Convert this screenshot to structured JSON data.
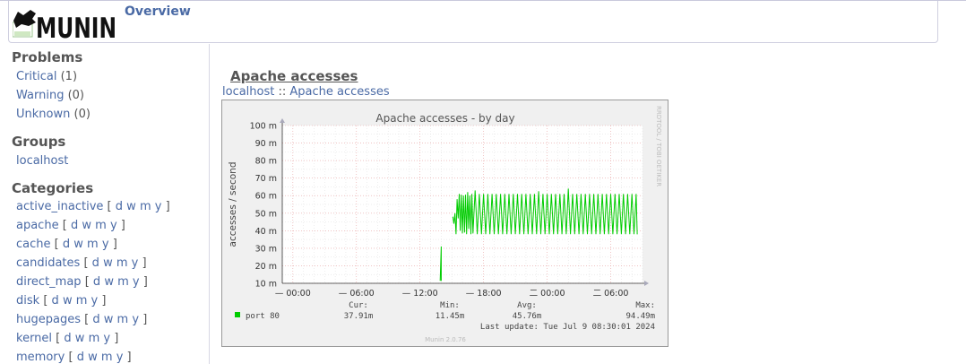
{
  "header": {
    "logo_text": "MUNIN",
    "overview_label": "Overview"
  },
  "sidebar": {
    "problems": {
      "title": "Problems",
      "items": [
        {
          "label": "Critical",
          "count": "(1)"
        },
        {
          "label": "Warning",
          "count": "(0)"
        },
        {
          "label": "Unknown",
          "count": "(0)"
        }
      ]
    },
    "groups": {
      "title": "Groups",
      "items": [
        {
          "label": "localhost"
        }
      ]
    },
    "categories": {
      "title": "Categories",
      "period_labels": [
        "d",
        "w",
        "m",
        "y"
      ],
      "items": [
        {
          "label": "active_inactive"
        },
        {
          "label": "apache"
        },
        {
          "label": "cache"
        },
        {
          "label": "candidates"
        },
        {
          "label": "direct_map"
        },
        {
          "label": "disk"
        },
        {
          "label": "hugepages"
        },
        {
          "label": "kernel"
        },
        {
          "label": "memory"
        }
      ]
    }
  },
  "main": {
    "title": "Apache accesses",
    "breadcrumb": {
      "host": "localhost",
      "separator": "::",
      "page": "Apache accesses"
    }
  },
  "graph": {
    "side_text": "RRDTOOL / TOBI OETIKER",
    "footer_text": "Munin 2.0.76",
    "last_update_label": "Last update:",
    "last_update_value": "Tue Jul  9 08:30:01 2024",
    "legend": {
      "headers": [
        "Cur:",
        "Min:",
        "Avg:",
        "Max:"
      ],
      "rows": [
        {
          "name": "port 80",
          "color": "#00cc00",
          "values": [
            "37.91m",
            "11.45m",
            "45.76m",
            "94.49m"
          ]
        }
      ]
    }
  },
  "colors": {
    "link": "#4a6aa5",
    "series": "#00cc00",
    "grid_major": "#e6a0a0",
    "grid_minor": "#dcdcdc",
    "plot_bg": "#ffffff",
    "graph_bg": "#f0f0f0"
  },
  "chart_data": {
    "type": "line",
    "title": "Apache accesses - by day",
    "xlabel": "",
    "ylabel": "accesses / second",
    "x_unit": "hours",
    "x_tick_labels": [
      "00:00",
      "06:00",
      "12:00",
      "18:00",
      "00:00",
      "06:00"
    ],
    "x_tick_label_markers": [
      "—",
      "—",
      "—",
      "—",
      "二",
      "二"
    ],
    "x_tick_hours": [
      0,
      6,
      12,
      18,
      24,
      30
    ],
    "xlim": [
      -1,
      33
    ],
    "y_tick_labels": [
      "10 m",
      "20 m",
      "30 m",
      "40 m",
      "50 m",
      "60 m",
      "70 m",
      "80 m",
      "90 m",
      "100 m"
    ],
    "y_tick_values": [
      10,
      20,
      30,
      40,
      50,
      60,
      70,
      80,
      90,
      100
    ],
    "ylim": [
      10,
      100
    ],
    "y_unit": "m",
    "grid": true,
    "series": [
      {
        "name": "port 80",
        "color": "#00cc00",
        "x": [
          13.9,
          14.0,
          14.0,
          15.1,
          15.2,
          15.3,
          15.4,
          15.5,
          15.6,
          15.7,
          15.8,
          15.9,
          16.0,
          16.1,
          16.2,
          16.3,
          16.4,
          16.5,
          16.6,
          16.7,
          16.8,
          16.9,
          17.0,
          17.2,
          17.4,
          17.6,
          17.8,
          18.0,
          18.2,
          18.4,
          18.6,
          18.8,
          19.0,
          19.2,
          19.4,
          19.6,
          19.8,
          20.0,
          20.2,
          20.4,
          20.6,
          20.8,
          21.0,
          21.2,
          21.4,
          21.6,
          21.8,
          22.0,
          22.2,
          22.4,
          22.6,
          22.8,
          23.0,
          23.2,
          23.4,
          23.6,
          23.8,
          24.0,
          24.2,
          24.4,
          24.6,
          24.8,
          25.0,
          25.2,
          25.4,
          25.6,
          25.8,
          26.0,
          26.2,
          26.4,
          26.6,
          26.8,
          27.0,
          27.2,
          27.4,
          27.6,
          27.8,
          28.0,
          28.2,
          28.4,
          28.6,
          28.8,
          29.0,
          29.2,
          29.4,
          29.6,
          29.8,
          30.0,
          30.2,
          30.4,
          30.6,
          30.8,
          31.0,
          31.2,
          31.4,
          31.6,
          31.8,
          32.0,
          32.2,
          32.4,
          32.5
        ],
        "y": [
          11.45,
          31.0,
          11.45,
          48.0,
          44.0,
          50.0,
          38.0,
          58.0,
          47.0,
          61.0,
          40.0,
          60.5,
          38.5,
          60.0,
          39.0,
          60.5,
          38.0,
          62.0,
          41.0,
          60.0,
          38.0,
          61.0,
          38.5,
          63.0,
          38.0,
          61.0,
          38.0,
          61.0,
          38.0,
          61.0,
          38.0,
          61.0,
          38.0,
          61.0,
          38.0,
          61.0,
          38.0,
          61.0,
          38.0,
          61.0,
          38.0,
          61.0,
          38.0,
          61.0,
          38.0,
          61.0,
          38.0,
          61.0,
          38.0,
          61.0,
          38.0,
          61.0,
          38.0,
          62.5,
          38.0,
          61.0,
          38.0,
          61.0,
          38.0,
          61.0,
          38.0,
          61.0,
          38.0,
          61.0,
          38.0,
          61.0,
          38.0,
          64.0,
          38.0,
          61.0,
          38.0,
          61.0,
          38.0,
          61.0,
          38.0,
          61.0,
          38.0,
          61.0,
          38.0,
          61.0,
          38.0,
          61.0,
          38.0,
          61.0,
          38.0,
          61.0,
          38.0,
          61.0,
          38.0,
          61.0,
          38.0,
          61.0,
          38.0,
          61.0,
          38.0,
          61.0,
          38.0,
          61.0,
          38.0,
          61.0,
          37.91
        ]
      }
    ]
  }
}
